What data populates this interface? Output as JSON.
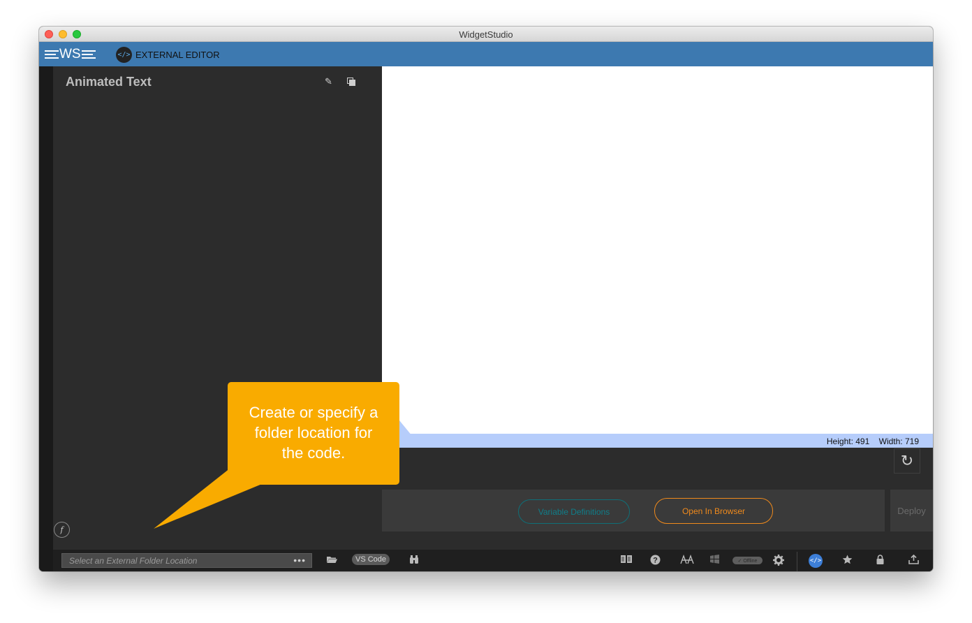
{
  "window": {
    "title": "WidgetStudio"
  },
  "appbar": {
    "logo_text": "WS",
    "mode_label": "EXTERNAL EDITOR",
    "mode_icon": "code-brackets-icon",
    "mode_icon_glyph": "</>"
  },
  "left_panel": {
    "title": "Animated Text",
    "edit_icon": "pencil-icon",
    "duplicate_icon": "duplicate-icon",
    "function_glyph": "f"
  },
  "preview": {
    "size_readout": {
      "height": "Height: 491",
      "width": "Width: 719"
    }
  },
  "actions": {
    "variable_definitions": "Variable Definitions",
    "open_in_browser": "Open In Browser",
    "deploy": "Deploy"
  },
  "bottom_bar": {
    "folder_placeholder": "Select an External Folder Location",
    "more_glyph": "•••",
    "vscode_label": "VS Code",
    "offline_label": "✓ Offline",
    "code_glyph": "</>"
  },
  "callout": {
    "line1": "Create or specify a",
    "line2": "folder location for",
    "line3": "the code."
  },
  "colors": {
    "accent_blue": "#3d79b0",
    "callout_orange": "#f9ab00",
    "open_browser_orange": "#f08a1c",
    "variable_teal": "#0f7e8a"
  }
}
